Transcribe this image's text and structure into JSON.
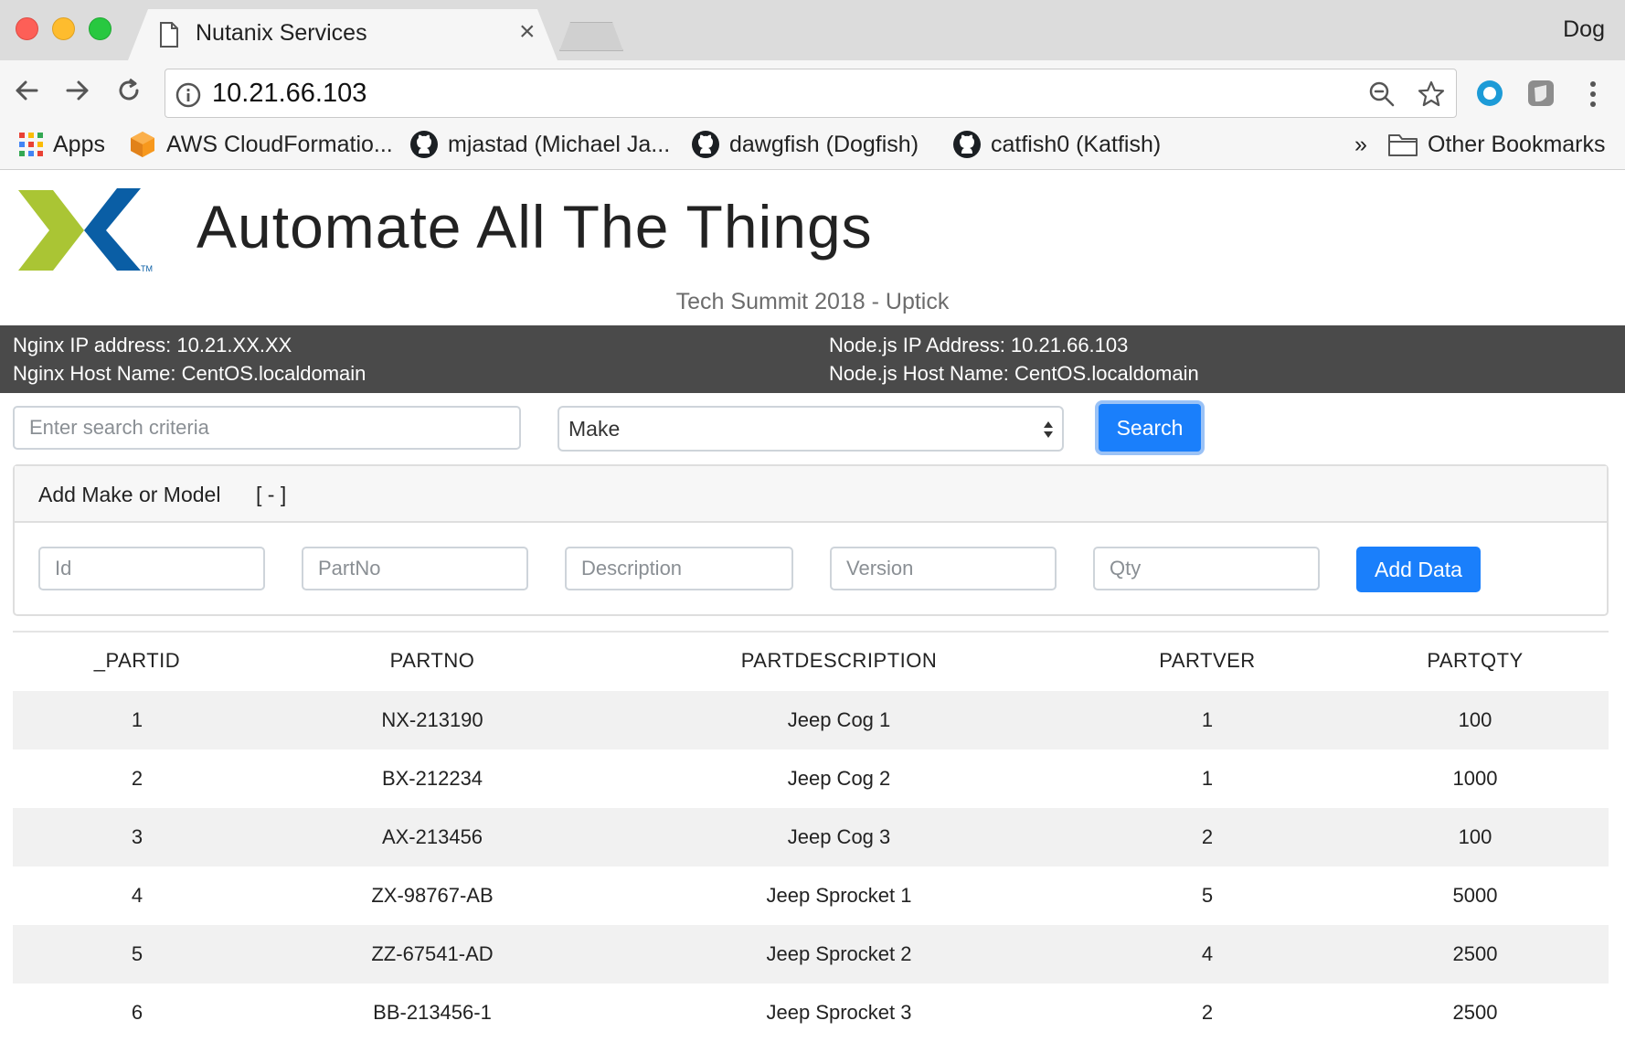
{
  "browser": {
    "tab_title": "Nutanix Services",
    "profile_name": "Dog",
    "url": "10.21.66.103",
    "bookmarks": [
      {
        "label": "Apps",
        "icon": "apps-grid-icon"
      },
      {
        "label": "AWS CloudFormatio...",
        "icon": "aws-cube-icon"
      },
      {
        "label": "mjastad (Michael Ja...",
        "icon": "github-icon"
      },
      {
        "label": "dawgfish (Dogfish)",
        "icon": "github-icon"
      },
      {
        "label": "catfish0 (Katfish)",
        "icon": "github-icon"
      }
    ],
    "overflow_label": "»",
    "other_bookmarks": "Other Bookmarks"
  },
  "header": {
    "title": "Automate All The Things",
    "subtitle": "Tech Summit 2018 - Uptick"
  },
  "info": {
    "nginx_ip": "Nginx IP address: 10.21.XX.XX",
    "nginx_host": "Nginx Host Name: CentOS.localdomain",
    "node_ip": "Node.js IP Address: 10.21.66.103",
    "node_host": "Node.js Host Name: CentOS.localdomain"
  },
  "search": {
    "placeholder": "Enter search criteria",
    "select_value": "Make",
    "button": "Search"
  },
  "add_card": {
    "title": "Add Make or Model",
    "toggle": "[ - ]",
    "fields": {
      "id": "Id",
      "partno": "PartNo",
      "description": "Description",
      "version": "Version",
      "qty": "Qty"
    },
    "button": "Add Data"
  },
  "table": {
    "headers": [
      "_PARTID",
      "PARTNO",
      "PARTDESCRIPTION",
      "PARTVER",
      "PARTQTY"
    ],
    "rows": [
      [
        "1",
        "NX-213190",
        "Jeep Cog 1",
        "1",
        "100"
      ],
      [
        "2",
        "BX-212234",
        "Jeep Cog 2",
        "1",
        "1000"
      ],
      [
        "3",
        "AX-213456",
        "Jeep Cog 3",
        "2",
        "100"
      ],
      [
        "4",
        "ZX-98767-AB",
        "Jeep Sprocket 1",
        "5",
        "5000"
      ],
      [
        "5",
        "ZZ-67541-AD",
        "Jeep Sprocket 2",
        "4",
        "2500"
      ],
      [
        "6",
        "BB-213456-1",
        "Jeep Sprocket 3",
        "2",
        "2500"
      ]
    ]
  },
  "colors": {
    "primary": "#1a7ffb",
    "info_bar": "#4a4a4a",
    "logo_green": "#aac534",
    "logo_blue": "#0a5ea5"
  }
}
